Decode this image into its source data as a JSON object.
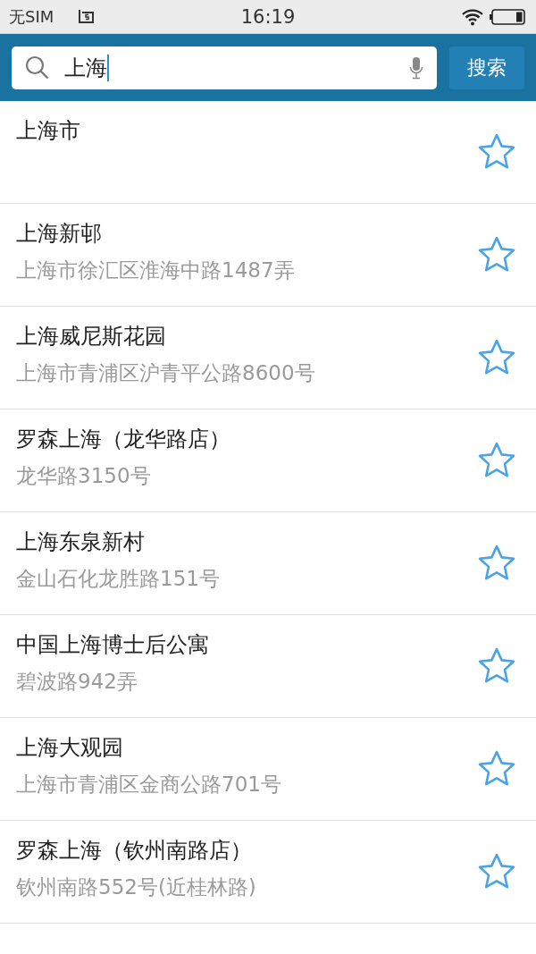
{
  "status_bar": {
    "carrier": "无SIM",
    "time": "16:19"
  },
  "search": {
    "value": "上海",
    "button": "搜索"
  },
  "results": [
    {
      "name": "上海市",
      "favorited": false
    },
    {
      "name": "上海新邨",
      "address": "上海市徐汇区淮海中路1487弄",
      "favorited": false
    },
    {
      "name": "上海威尼斯花园",
      "address": "上海市青浦区沪青平公路8600号",
      "favorited": false
    },
    {
      "name": "罗森上海（龙华路店）",
      "address": "龙华路3150号",
      "favorited": false
    },
    {
      "name": "上海东泉新村",
      "address": "金山石化龙胜路151号",
      "favorited": false
    },
    {
      "name": "中国上海博士后公寓",
      "address": "碧波路942弄",
      "favorited": false
    },
    {
      "name": "上海大观园",
      "address": "上海市青浦区金商公路701号",
      "favorited": false
    },
    {
      "name": "罗森上海（钦州南路店）",
      "address": "钦州南路552号(近桂林路)",
      "favorited": false
    }
  ]
}
